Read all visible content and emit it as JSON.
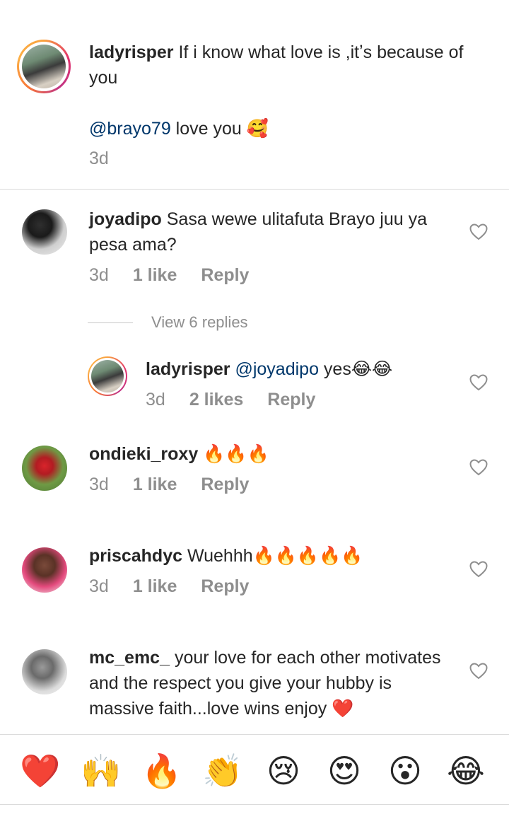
{
  "comments": [
    {
      "username": "ladyrisper",
      "text": "If i know what love is ,itʼs because of you",
      "mention": "@brayo79",
      "text2": " love you 🥰",
      "time": "3d"
    },
    {
      "username": "joyadipo",
      "text": "Sasa wewe ulitafuta Brayo juu ya pesa ama?",
      "time": "3d",
      "likes": "1 like",
      "reply": "Reply",
      "view_replies": "View 6 replies"
    },
    {
      "username": "ladyrisper",
      "mention": "@joyadipo",
      "text": " yes😂😂",
      "time": "3d",
      "likes": "2 likes",
      "reply": "Reply"
    },
    {
      "username": "ondieki_roxy",
      "text": "🔥🔥🔥",
      "time": "3d",
      "likes": "1 like",
      "reply": "Reply"
    },
    {
      "username": "priscahdyc",
      "text": "Wuehhh🔥🔥🔥🔥🔥",
      "time": "3d",
      "likes": "1 like",
      "reply": "Reply"
    },
    {
      "username": "mc_emc_",
      "text": "your love for  each other motivates and the respect you give your hubby is massive faith...love wins enjoy ❤️"
    }
  ],
  "emoji_bar": [
    "❤️",
    "🙌",
    "🔥",
    "👏",
    "😢",
    "😍",
    "😮",
    "😂"
  ],
  "colors": {
    "text": "#262626",
    "secondary": "#8e8e8e",
    "mention": "#00376b",
    "divider": "#dbdbdb"
  }
}
